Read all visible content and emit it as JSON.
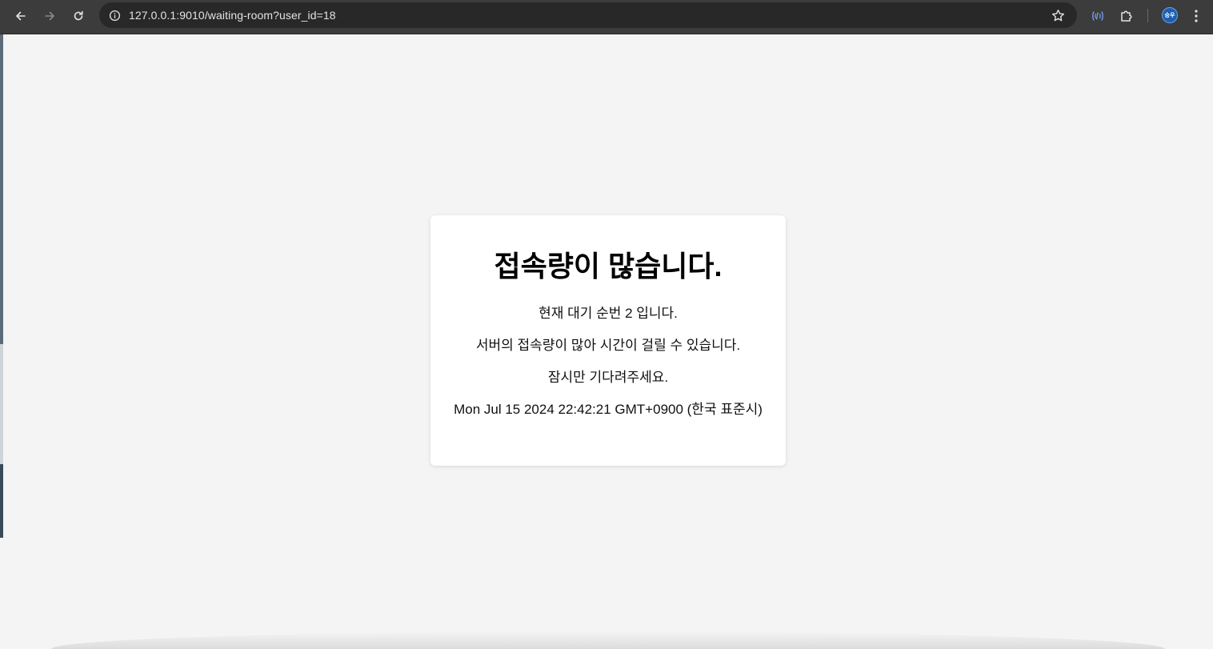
{
  "browser": {
    "url": "127.0.0.1:9010/waiting-room?user_id=18",
    "avatar_text": "승우"
  },
  "page": {
    "title": "접속량이 많습니다.",
    "queue_message": "현재 대기 순번 2 입니다.",
    "server_message": "서버의 접속량이 많아 시간이 걸릴 수 있습니다.",
    "wait_message": "잠시만 기다려주세요.",
    "timestamp": "Mon Jul 15 2024 22:42:21 GMT+0900 (한국 표준시)"
  },
  "colors": {
    "toolbar": "#3c3c3c",
    "omnibox": "#282828",
    "page_background": "#f4f4f4",
    "card_background": "#ffffff",
    "avatar": "#1a5fb4",
    "cast_icon": "#7aa2f7"
  },
  "icons": {
    "back": "arrow-left-icon",
    "forward": "arrow-right-icon",
    "reload": "reload-icon",
    "site_info": "info-icon",
    "bookmark": "star-icon",
    "cast": "broadcast-icon",
    "extensions": "puzzle-icon",
    "menu": "kebab-menu-icon"
  }
}
